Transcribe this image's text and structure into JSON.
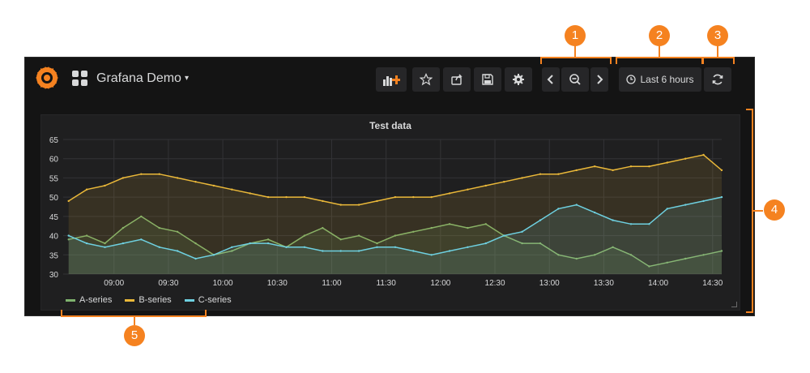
{
  "dashboard": {
    "title": "Grafana Demo",
    "title_caret": "▾"
  },
  "toolbar": {
    "add_panel_icon": "add-panel-icon",
    "star_icon": "star-icon",
    "share_icon": "share-icon",
    "save_icon": "save-icon",
    "settings_icon": "gear-icon",
    "prev_icon": "chevron-left-icon",
    "zoom_out_icon": "zoom-out-icon",
    "next_icon": "chevron-right-icon",
    "time_range_label": "Last 6 hours",
    "refresh_icon": "refresh-icon"
  },
  "callouts": [
    "1",
    "2",
    "3",
    "4",
    "5"
  ],
  "colors": {
    "accent": "#f58220",
    "background": "#141414",
    "panel": "#1f1f20",
    "a_series": "#7eb26d",
    "b_series": "#eab839",
    "c_series": "#6ed0e0"
  },
  "chart_data": {
    "type": "line",
    "title": "Test data",
    "xlabel": "",
    "ylabel": "",
    "ylim": [
      30,
      65
    ],
    "yticks": [
      30,
      35,
      40,
      45,
      50,
      55,
      60,
      65
    ],
    "xticks": [
      "09:00",
      "09:30",
      "10:00",
      "10:30",
      "11:00",
      "11:30",
      "12:00",
      "12:30",
      "13:00",
      "13:30",
      "14:00",
      "14:30"
    ],
    "grid": true,
    "fill": true,
    "legend_position": "bottom-left",
    "x": [
      "08:35",
      "08:45",
      "08:55",
      "09:05",
      "09:15",
      "09:25",
      "09:35",
      "09:45",
      "09:55",
      "10:05",
      "10:15",
      "10:25",
      "10:35",
      "10:45",
      "10:55",
      "11:05",
      "11:15",
      "11:25",
      "11:35",
      "11:45",
      "11:55",
      "12:05",
      "12:15",
      "12:25",
      "12:35",
      "12:45",
      "12:55",
      "13:05",
      "13:15",
      "13:25",
      "13:35",
      "13:45",
      "13:55",
      "14:05",
      "14:15",
      "14:25",
      "14:35"
    ],
    "series": [
      {
        "name": "A-series",
        "color": "#7eb26d",
        "values": [
          39,
          40,
          38,
          42,
          45,
          42,
          41,
          38,
          35,
          36,
          38,
          39,
          37,
          40,
          42,
          39,
          40,
          38,
          40,
          41,
          42,
          43,
          42,
          43,
          40,
          38,
          38,
          35,
          34,
          35,
          37,
          35,
          32,
          33,
          34,
          35,
          36
        ]
      },
      {
        "name": "B-series",
        "color": "#eab839",
        "values": [
          49,
          52,
          53,
          55,
          56,
          56,
          55,
          54,
          53,
          52,
          51,
          50,
          50,
          50,
          49,
          48,
          48,
          49,
          50,
          50,
          50,
          51,
          52,
          53,
          54,
          55,
          56,
          56,
          57,
          58,
          57,
          58,
          58,
          59,
          60,
          61,
          57
        ]
      },
      {
        "name": "C-series",
        "color": "#6ed0e0",
        "values": [
          40,
          38,
          37,
          38,
          39,
          37,
          36,
          34,
          35,
          37,
          38,
          38,
          37,
          37,
          36,
          36,
          36,
          37,
          37,
          36,
          35,
          36,
          37,
          38,
          40,
          41,
          44,
          47,
          48,
          46,
          44,
          43,
          43,
          47,
          48,
          49,
          50
        ]
      }
    ]
  }
}
